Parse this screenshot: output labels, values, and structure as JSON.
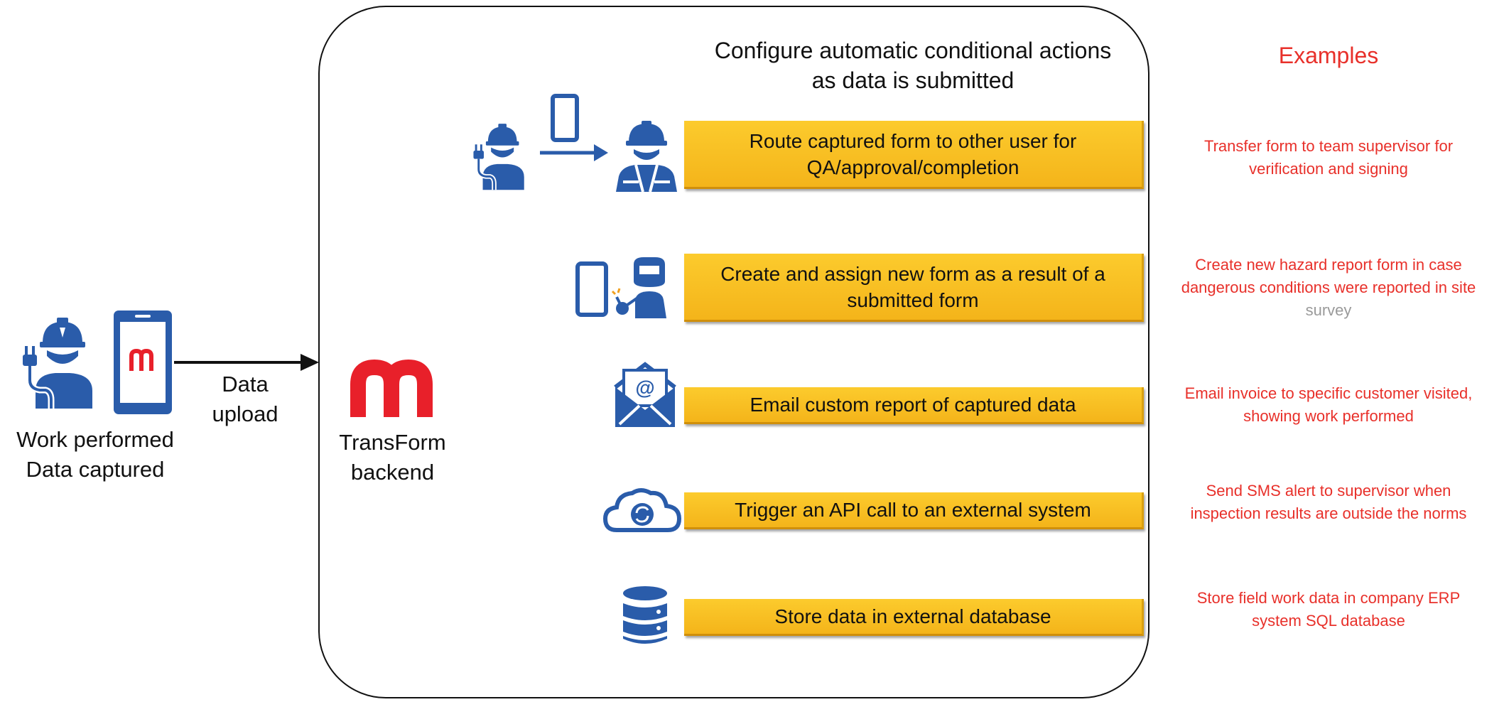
{
  "colors": {
    "icon_blue": "#2a5caa",
    "action_yellow": "#f7be23",
    "example_red": "#e8302a",
    "logo_red": "#e8202a"
  },
  "left": {
    "icons": [
      "worker-with-plug-icon",
      "phone-with-logo-icon"
    ],
    "caption_line1": "Work performed",
    "caption_line2": "Data captured"
  },
  "arrow": {
    "label_line1": "Data",
    "label_line2": "upload"
  },
  "backend": {
    "logo": "m",
    "label_line1": "TransForm",
    "label_line2": "backend"
  },
  "heading": {
    "line1": "Configure automatic conditional actions",
    "line2": "as data is submitted"
  },
  "examples_title": "Examples",
  "actions": [
    {
      "icons": [
        "worker-icon",
        "phone-transfer-icon",
        "supervisor-icon"
      ],
      "line1": "Route captured form to other user for",
      "line2": "QA/approval/completion",
      "example_line1": "Transfer form to team supervisor for",
      "example_line2": "verification and signing"
    },
    {
      "icons": [
        "phone-icon",
        "welder-icon"
      ],
      "line1": "Create and assign new form as a result of a",
      "line2": "submitted form",
      "example_line1": "Create new hazard report form in case",
      "example_line2": "dangerous conditions were reported in site",
      "example_line3": "survey"
    },
    {
      "icons": [
        "email-icon"
      ],
      "line1": "Email custom report of captured data",
      "example_line1": "Email invoice to specific customer visited,",
      "example_line2": "showing work performed"
    },
    {
      "icons": [
        "cloud-sync-icon"
      ],
      "line1": "Trigger an API call to an external system",
      "example_line1": "Send SMS alert to supervisor when",
      "example_line2": "inspection results are outside the norms"
    },
    {
      "icons": [
        "database-icon"
      ],
      "line1": "Store data in external database",
      "example_line1": "Store field work data in company ERP",
      "example_line2": "system SQL database"
    }
  ]
}
